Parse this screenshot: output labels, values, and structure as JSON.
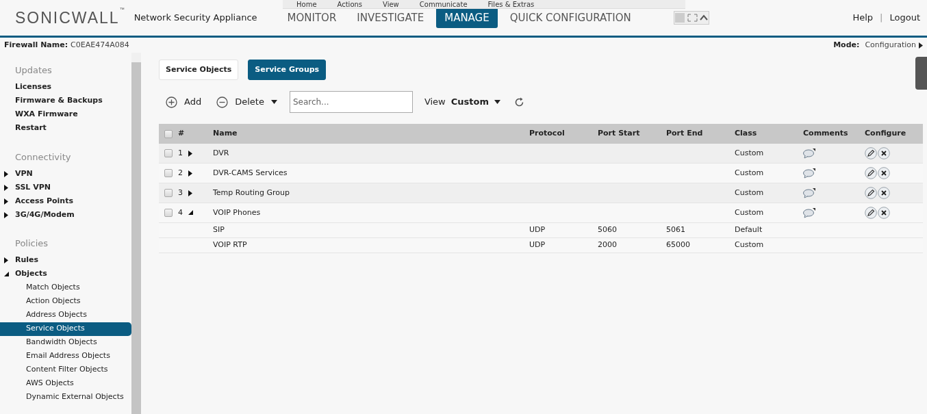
{
  "remote_toolbar": {
    "items": [
      "Home",
      "Actions",
      "View",
      "Communicate",
      "Files & Extras"
    ]
  },
  "header": {
    "brand": "SONICWALL",
    "brand_mark": "™",
    "product": "Network Security Appliance",
    "tabs": [
      {
        "label": "MONITOR",
        "selected": false
      },
      {
        "label": "INVESTIGATE",
        "selected": false
      },
      {
        "label": "MANAGE",
        "selected": true
      },
      {
        "label": "QUICK CONFIGURATION",
        "selected": false
      }
    ],
    "links": [
      "Help",
      "|",
      "Logout"
    ]
  },
  "info_bar": {
    "firewall_label": "Firewall Name:",
    "firewall_name": "C0EAE474A084",
    "mode_label": "Mode:",
    "mode_value": "Configuration"
  },
  "sidebar": {
    "sections": [
      {
        "title": "Updates",
        "items": [
          {
            "label": "Licenses",
            "kind": "leaf"
          },
          {
            "label": "Firmware & Backups",
            "kind": "leaf"
          },
          {
            "label": "WXA Firmware",
            "kind": "leaf"
          },
          {
            "label": "Restart",
            "kind": "leaf"
          }
        ]
      },
      {
        "title": "Connectivity",
        "items": [
          {
            "label": "VPN",
            "kind": "folder",
            "expanded": false
          },
          {
            "label": "SSL VPN",
            "kind": "folder",
            "expanded": false
          },
          {
            "label": "Access Points",
            "kind": "folder",
            "expanded": false
          },
          {
            "label": "3G/4G/Modem",
            "kind": "folder",
            "expanded": false
          }
        ]
      },
      {
        "title": "Policies",
        "items": [
          {
            "label": "Rules",
            "kind": "folder",
            "expanded": false
          },
          {
            "label": "Objects",
            "kind": "folder",
            "expanded": true,
            "children": [
              {
                "label": "Match Objects",
                "selected": false
              },
              {
                "label": "Action Objects",
                "selected": false
              },
              {
                "label": "Address Objects",
                "selected": false
              },
              {
                "label": "Service Objects",
                "selected": true
              },
              {
                "label": "Bandwidth Objects",
                "selected": false
              },
              {
                "label": "Email Address Objects",
                "selected": false
              },
              {
                "label": "Content Filter Objects",
                "selected": false
              },
              {
                "label": "AWS Objects",
                "selected": false
              },
              {
                "label": "Dynamic External Objects",
                "selected": false
              }
            ]
          }
        ]
      }
    ]
  },
  "view_tabs": [
    {
      "label": "Service Objects",
      "selected": false
    },
    {
      "label": "Service Groups",
      "selected": true
    }
  ],
  "toolbar": {
    "add": "Add",
    "delete": "Delete",
    "search": {
      "placeholder": "Search..."
    },
    "view_label": "View",
    "view_value": "Custom"
  },
  "table": {
    "columns": [
      "#",
      "Name",
      "Protocol",
      "Port Start",
      "Port End",
      "Class",
      "Comments",
      "Configure"
    ],
    "header_checked": false,
    "rows": [
      {
        "number": "1",
        "name": "DVR",
        "class": "Custom",
        "checked": false,
        "expanded": false
      },
      {
        "number": "2",
        "name": "DVR-CAMS Services",
        "class": "Custom",
        "checked": false,
        "expanded": false
      },
      {
        "number": "3",
        "name": "Temp Routing Group",
        "class": "Custom",
        "checked": false,
        "expanded": false
      },
      {
        "number": "4",
        "name": "VOIP Phones",
        "class": "Custom",
        "checked": false,
        "expanded": true,
        "children": [
          {
            "name": "SIP",
            "protocol": "UDP",
            "port_start": "5060",
            "port_end": "5061",
            "class": "Default"
          },
          {
            "name": "VOIP RTP",
            "protocol": "UDP",
            "port_start": "2000",
            "port_end": "65000",
            "class": "Custom"
          }
        ]
      }
    ]
  }
}
